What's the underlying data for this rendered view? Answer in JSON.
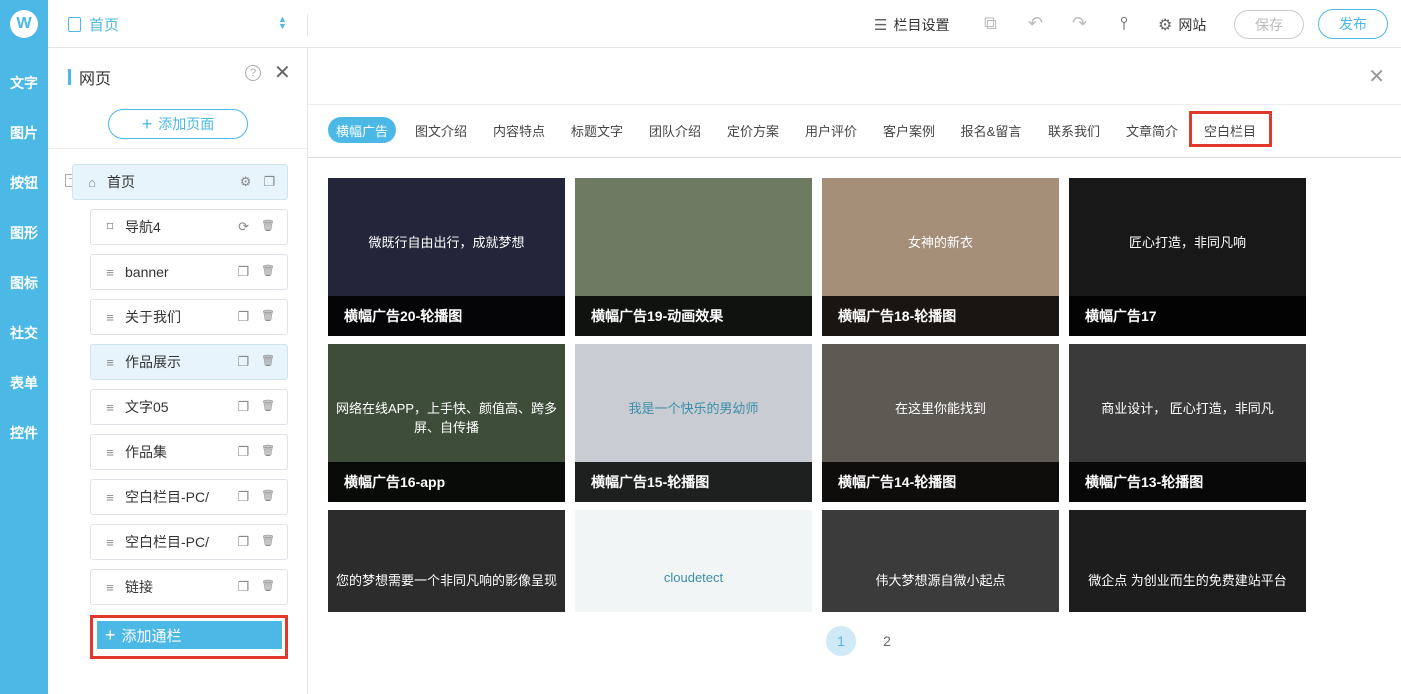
{
  "sidebar": {
    "logo": "W",
    "items": [
      "文字",
      "图片",
      "按钮",
      "图形",
      "图标",
      "社交",
      "表单",
      "控件"
    ]
  },
  "topbar": {
    "page_selector": "首页",
    "column_settings": "栏目设置",
    "website": "网站",
    "save": "保存",
    "publish": "发布"
  },
  "panel": {
    "title": "网页",
    "add_page": "添加页面",
    "home": "首页",
    "items": [
      {
        "label": "导航4",
        "icon": "bookmark-icon"
      },
      {
        "label": "banner",
        "icon": "menu-icon"
      },
      {
        "label": "关于我们",
        "icon": "menu-icon"
      },
      {
        "label": "作品展示",
        "icon": "menu-icon"
      },
      {
        "label": "文字05",
        "icon": "menu-icon"
      },
      {
        "label": "作品集",
        "icon": "menu-icon"
      },
      {
        "label": "空白栏目-PC/",
        "icon": "menu-icon"
      },
      {
        "label": "空白栏目-PC/",
        "icon": "menu-icon"
      },
      {
        "label": "链接",
        "icon": "menu-icon"
      }
    ],
    "add_column": "添加通栏"
  },
  "tabs": [
    "横幅广告",
    "图文介绍",
    "内容特点",
    "标题文字",
    "团队介绍",
    "定价方案",
    "用户评价",
    "客户案例",
    "报名&留言",
    "联系我们",
    "文章简介",
    "空白栏目"
  ],
  "active_tab": "横幅广告",
  "cards": [
    {
      "title": "横幅广告20-轮播图",
      "overlay": "微既行自由出行，成就梦想",
      "bg": "#23263a"
    },
    {
      "title": "横幅广告19-动画效果",
      "overlay": "",
      "bg": "#6f7a63"
    },
    {
      "title": "横幅广告18-轮播图",
      "overlay": "女神的新衣",
      "bg": "#a68f79"
    },
    {
      "title": "横幅广告17",
      "overlay": "匠心打造，非同凡响",
      "bg": "#181818"
    },
    {
      "title": "横幅广告16-app",
      "overlay": "网络在线APP，上手快、颜值高、跨多屏、自传播",
      "bg": "#3e4c3a"
    },
    {
      "title": "横幅广告15-轮播图",
      "overlay": "我是一个快乐的男幼师",
      "bg": "#c9ccd2"
    },
    {
      "title": "横幅广告14-轮播图",
      "overlay": "在这里你能找到",
      "bg": "#5d5a54"
    },
    {
      "title": "横幅广告13-轮播图",
      "overlay": "商业设计， 匠心打造，非同凡",
      "bg": "#3a3a3a"
    },
    {
      "title": "",
      "overlay": "您的梦想需要一个非同凡响的影像呈现",
      "bg": "#2c2c2c"
    },
    {
      "title": "",
      "overlay": "cloudetect",
      "bg": "#f2f5f6"
    },
    {
      "title": "",
      "overlay": "伟大梦想源自微小起点",
      "bg": "#3b3b3b"
    },
    {
      "title": "",
      "overlay": "微企点 为创业而生的免费建站平台",
      "bg": "#1d1d1d"
    }
  ],
  "pagination": [
    "1",
    "2"
  ]
}
